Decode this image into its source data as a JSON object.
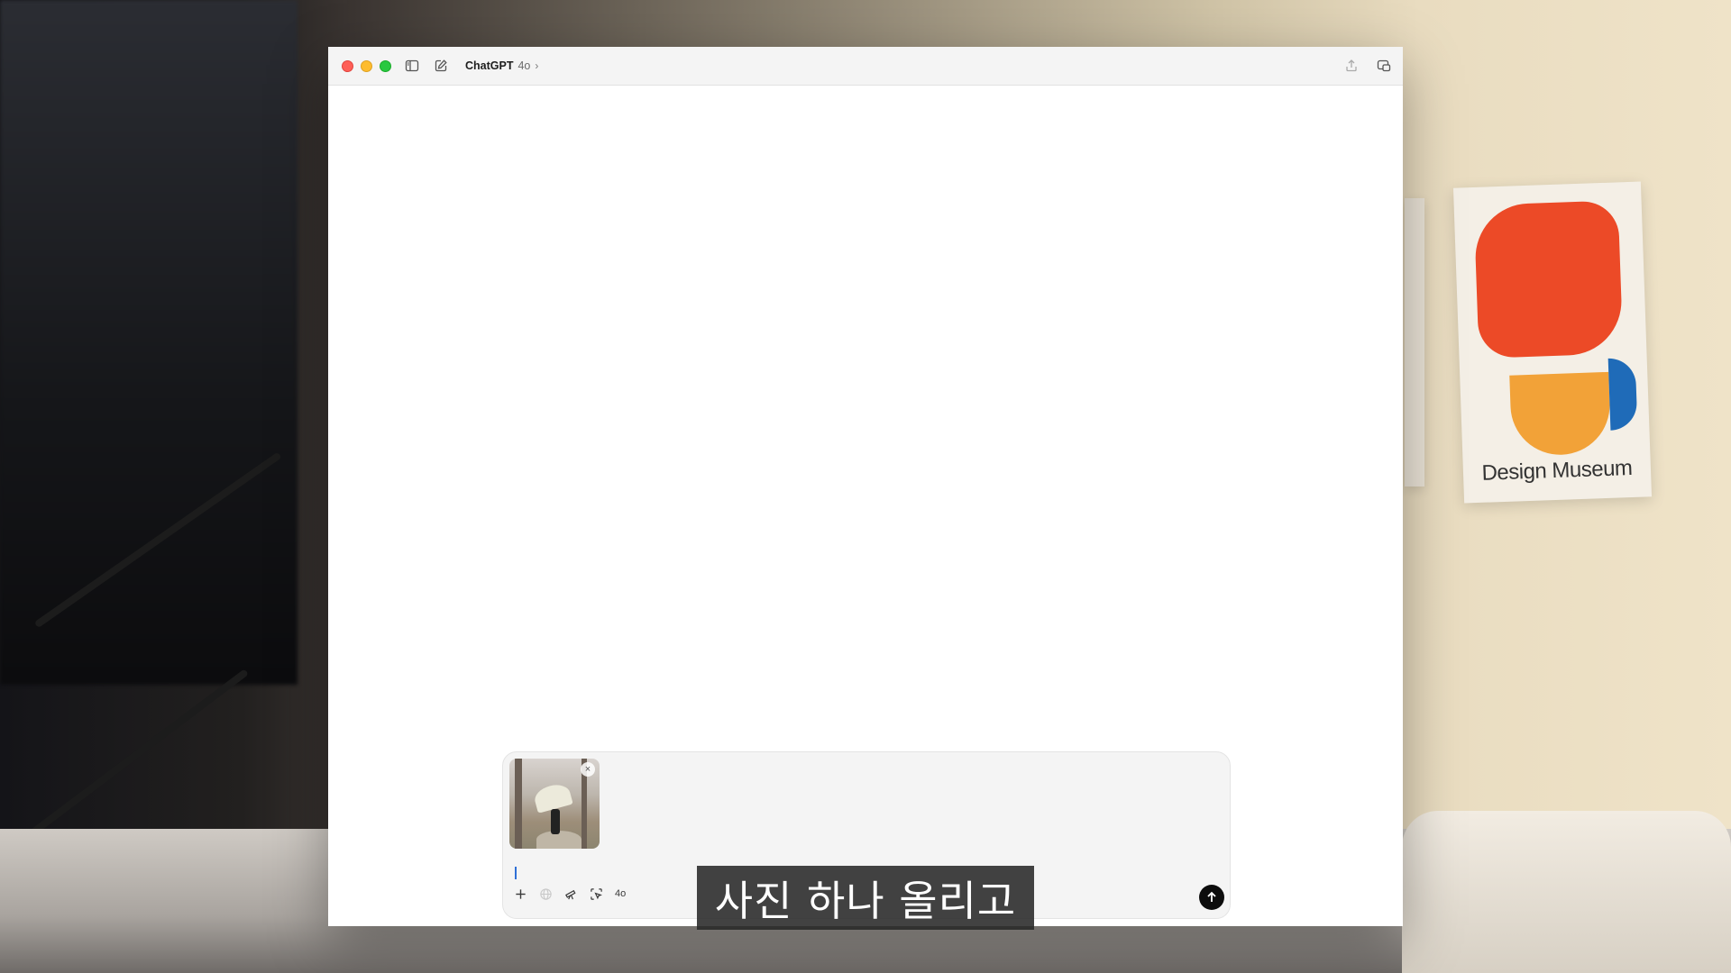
{
  "background": {
    "poster_text": "Design Museum"
  },
  "window": {
    "title": "ChatGPT",
    "model": "4o",
    "icons": {
      "sidebar": "sidebar-toggle-icon",
      "new_chat": "new-chat-icon",
      "share": "share-icon",
      "popout": "popout-window-icon"
    }
  },
  "composer": {
    "attachment": {
      "description_icon": "image-thumbnail",
      "remove_icon": "close-icon"
    },
    "input_value": "",
    "input_placeholder": "",
    "tools": {
      "add": "plus-icon",
      "web": "globe-icon",
      "tools": "telescope-icon",
      "screenshot": "screen-capture-icon",
      "model_label": "4o"
    },
    "send": "send-arrow-icon"
  },
  "caption": {
    "text": "사진 하나 올리고"
  }
}
